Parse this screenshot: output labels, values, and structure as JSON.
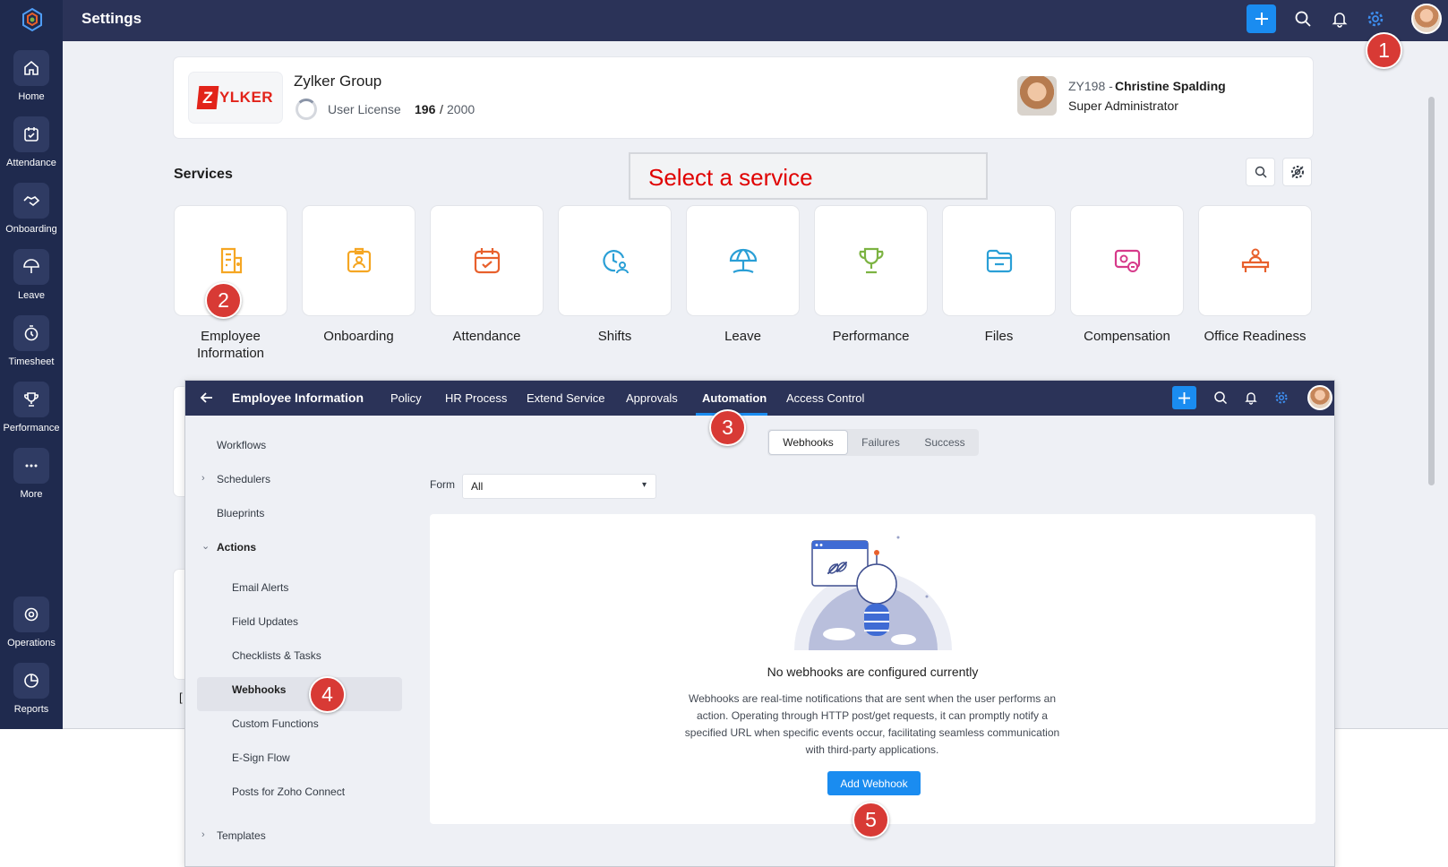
{
  "nav": {
    "items": [
      {
        "label": "Home"
      },
      {
        "label": "Attendance"
      },
      {
        "label": "Onboarding"
      },
      {
        "label": "Leave"
      },
      {
        "label": "Timesheet"
      },
      {
        "label": "Performance"
      },
      {
        "label": "More"
      },
      {
        "label": "Operations"
      },
      {
        "label": "Reports"
      }
    ]
  },
  "header": {
    "title": "Settings"
  },
  "org": {
    "logo_letter": "Z",
    "logo_text": "YLKER",
    "name": "Zylker Group",
    "license_label": "User License",
    "license_used": "196",
    "license_sep": "/",
    "license_total": "2000",
    "license_fraction": 0.098
  },
  "admin": {
    "id": "ZY198 -",
    "name": "Christine Spalding",
    "role": "Super Administrator"
  },
  "services": {
    "title": "Services",
    "callout": "Select a service",
    "items": [
      {
        "label": "Employee Information",
        "icon": "employee-info-icon",
        "color": "#f5a623"
      },
      {
        "label": "Onboarding",
        "icon": "onboarding-icon",
        "color": "#f5a623"
      },
      {
        "label": "Attendance",
        "icon": "calendar-icon",
        "color": "#e8602c"
      },
      {
        "label": "Shifts",
        "icon": "clock-user-icon",
        "color": "#2a9fd6"
      },
      {
        "label": "Leave",
        "icon": "umbrella-icon",
        "color": "#2a9fd6"
      },
      {
        "label": "Performance",
        "icon": "trophy-icon",
        "color": "#7cb342"
      },
      {
        "label": "Files",
        "icon": "folder-icon",
        "color": "#2a9fd6"
      },
      {
        "label": "Compensation",
        "icon": "compensation-icon",
        "color": "#d63a8a"
      },
      {
        "label": "Office Readiness",
        "icon": "desk-user-icon",
        "color": "#e8602c"
      }
    ]
  },
  "ghost_letter": "[",
  "module": {
    "title": "Employee Information",
    "tabs": [
      "Policy",
      "HR Process",
      "Extend Service",
      "Approvals",
      "Automation",
      "Access Control"
    ],
    "active_tab": "Automation"
  },
  "sidebar": {
    "workflows": "Workflows",
    "schedulers": "Schedulers",
    "blueprints": "Blueprints",
    "actions": "Actions",
    "actions_items": [
      "Email Alerts",
      "Field Updates",
      "Checklists & Tasks",
      "Webhooks",
      "Custom Functions",
      "E-Sign Flow",
      "Posts for Zoho Connect"
    ],
    "active_item": "Webhooks",
    "templates": "Templates"
  },
  "segment": {
    "options": [
      "Webhooks",
      "Failures",
      "Success"
    ],
    "active": "Webhooks"
  },
  "filter": {
    "label": "Form",
    "value": "All"
  },
  "empty": {
    "title": "No webhooks are configured currently",
    "description": "Webhooks are real-time notifications that are sent when the user performs an action. Operating through HTTP post/get requests, it can promptly notify a specified URL when specific events occur, facilitating seamless communication with third-party applications.",
    "button": "Add Webhook"
  },
  "steps": [
    "1",
    "2",
    "3",
    "4",
    "5"
  ],
  "colors": {
    "nav": "#1f2a4e",
    "topbar": "#2b3358",
    "accent": "#1a8cf0",
    "step": "#d83a35",
    "callout": "#e00000"
  }
}
